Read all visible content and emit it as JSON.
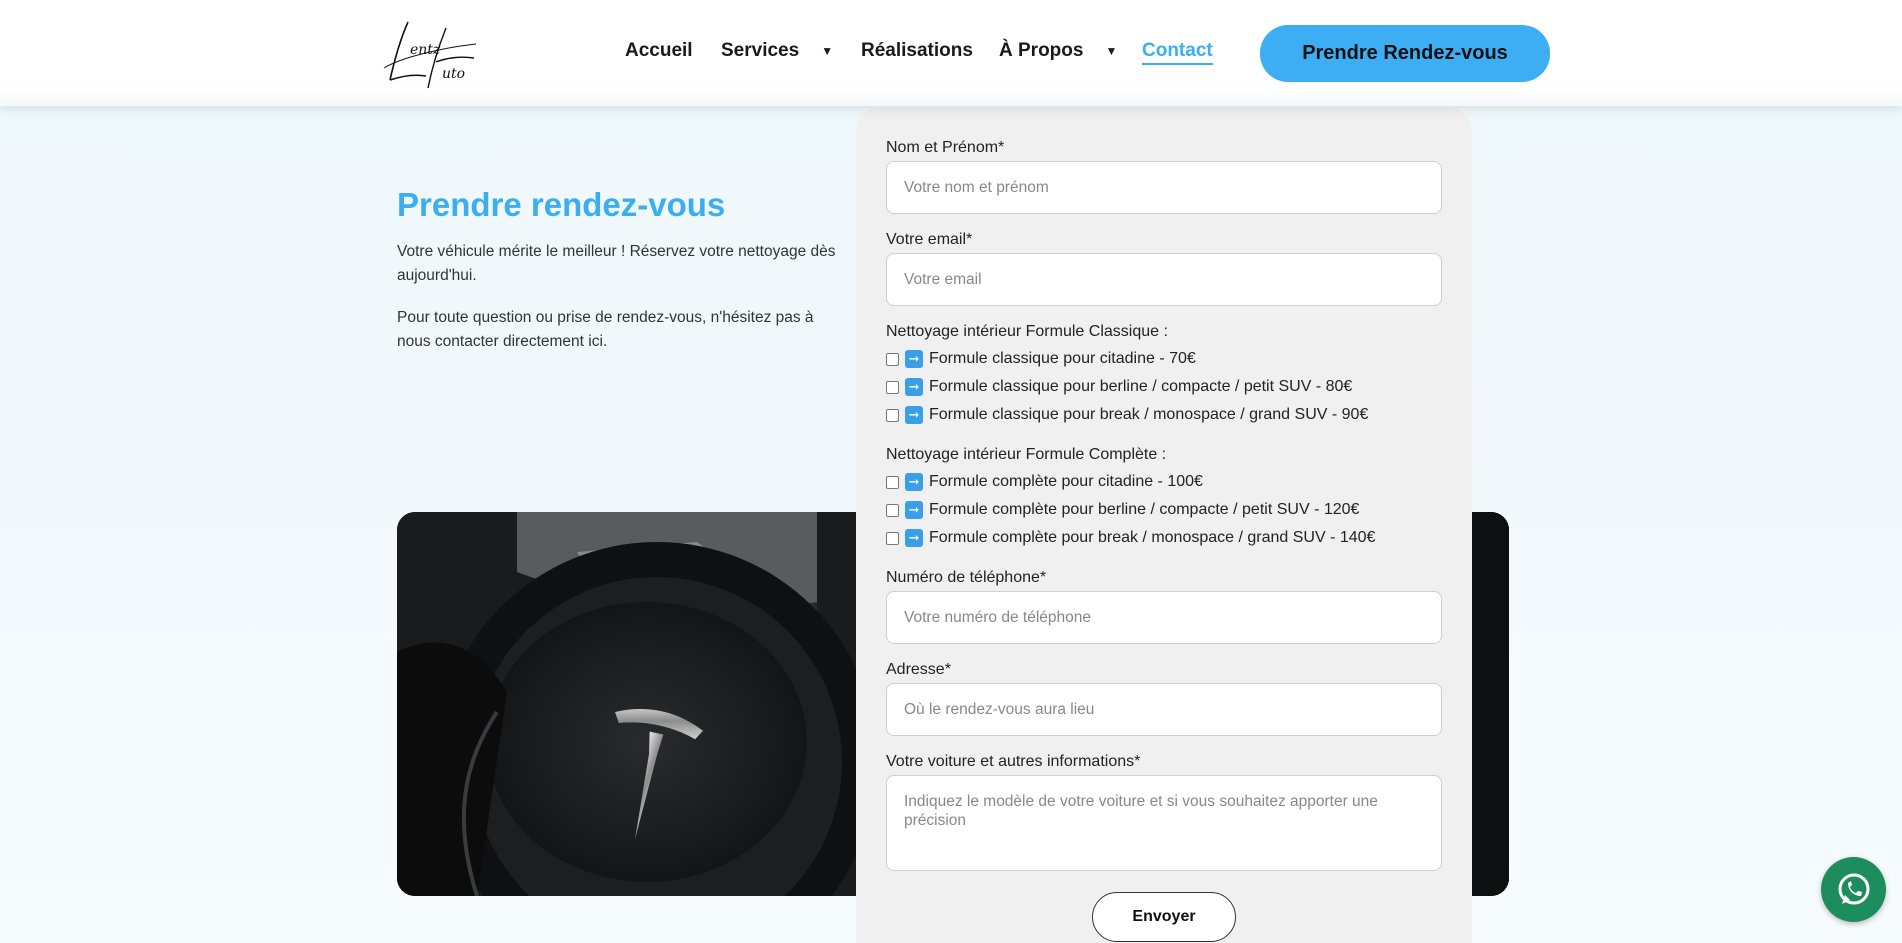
{
  "header": {
    "logo_alt": "Lentz Auto",
    "nav": [
      {
        "label": "Accueil"
      },
      {
        "label": "Services"
      },
      {
        "label": "Réalisations"
      },
      {
        "label": "À Propos"
      },
      {
        "label": "Contact"
      }
    ],
    "cta_label": "Prendre Rendez-vous"
  },
  "intro": {
    "title": "Prendre rendez-vous",
    "p1": "Votre véhicule mérite le meilleur ! Réservez votre nettoyage dès aujourd'hui.",
    "p2": "Pour toute question ou prise de rendez-vous, n'hésitez pas à nous contacter directement ici."
  },
  "form": {
    "name_label": "Nom et Prénom*",
    "name_placeholder": "Votre nom et prénom",
    "email_label": "Votre email*",
    "email_placeholder": "Votre email",
    "classic_heading": "Nettoyage intérieur Formule Classique :",
    "classic_options": [
      "Formule classique pour citadine - 70€",
      "Formule classique pour berline / compacte / petit SUV - 80€",
      "Formule classique pour break / monospace / grand SUV - 90€"
    ],
    "complete_heading": "Nettoyage intérieur Formule Complète :",
    "complete_options": [
      "Formule complète pour citadine - 100€",
      "Formule complète pour berline / compacte / petit SUV - 120€",
      "Formule complète pour break / monospace / grand SUV - 140€"
    ],
    "phone_label": "Numéro de téléphone*",
    "phone_placeholder": "Votre numéro de téléphone",
    "address_label": "Adresse*",
    "address_placeholder": "Où le rendez-vous aura lieu",
    "info_label": "Votre voiture et autres informations*",
    "info_placeholder": "Indiquez le modèle de votre voiture et si vous souhaitez apporter une précision",
    "submit_label": "Envoyer"
  },
  "colors": {
    "accent": "#3daef4",
    "whatsapp": "#1e8d5e"
  }
}
